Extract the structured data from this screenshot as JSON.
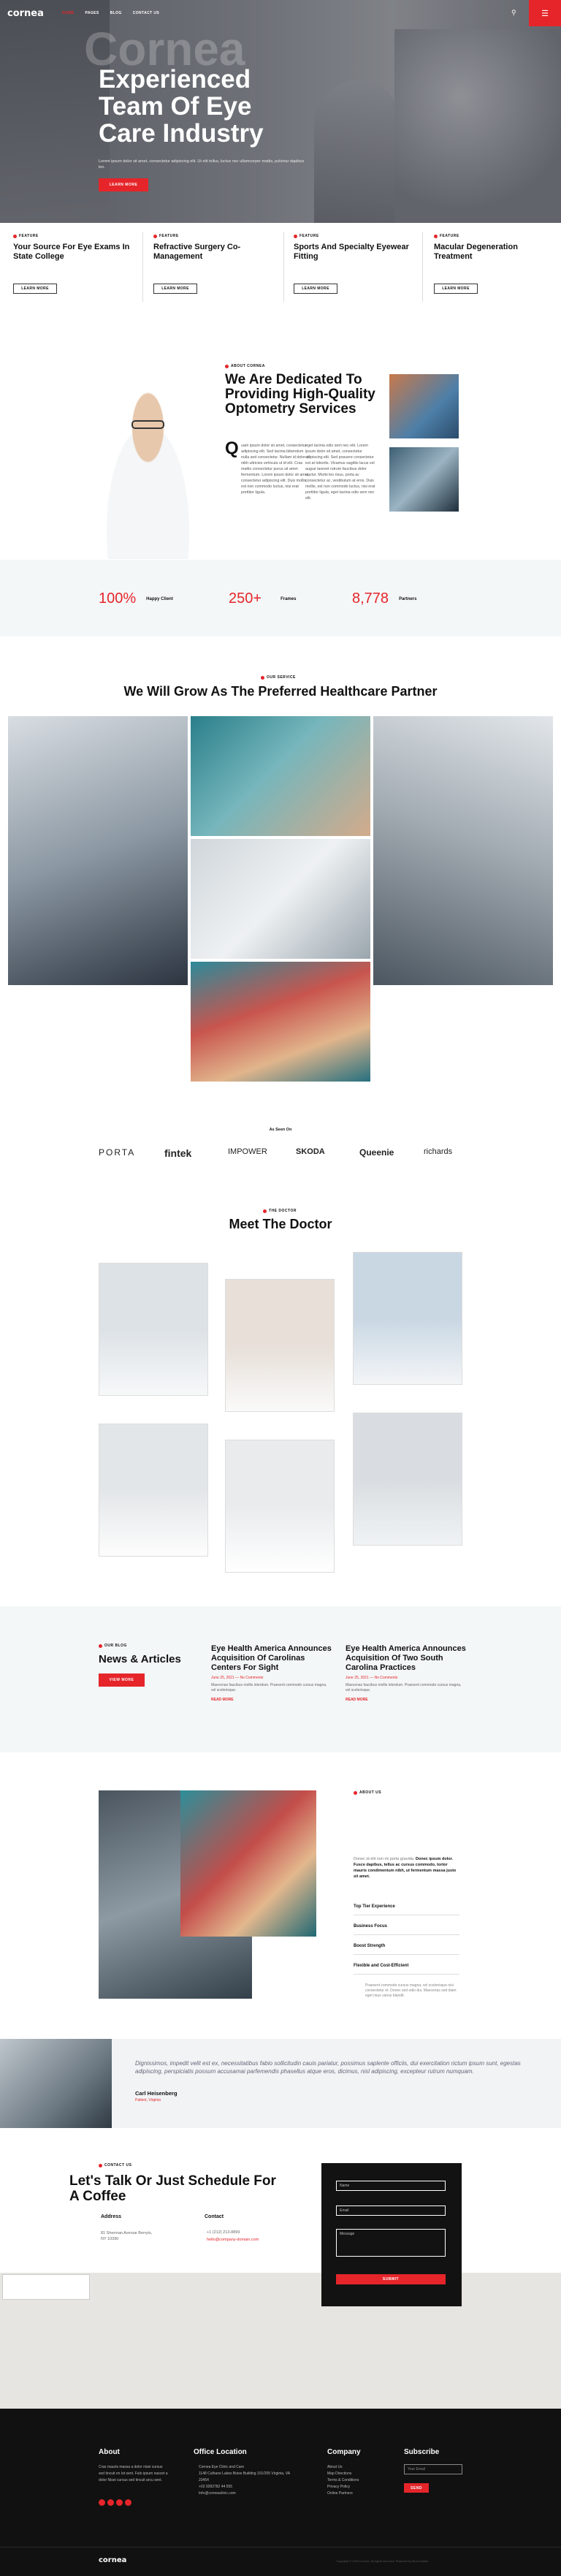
{
  "header": {
    "logo": "cornea",
    "nav": [
      "HOME",
      "PAGES",
      "BLOG",
      "CONTACT US"
    ],
    "search_icon": "search-icon",
    "menu_icon": "menu-icon"
  },
  "hero": {
    "watermark": "Cornea",
    "title_line1": "Experienced",
    "title_line2": "Team Of Eye",
    "title_line3": "Care Industry",
    "subtitle": "Lorem ipsum dolor sit amet, consectetur adipiscing elit. Ut elit tellus, luctus nec ullamcorper mattis, pulvinar dapibus leo.",
    "cta": "LEARN MORE"
  },
  "features": [
    {
      "tag": "FEATURE",
      "title": "Your Source For Eye Exams In State College",
      "cta": "LEARN MORE"
    },
    {
      "tag": "FEATURE",
      "title": "Refractive Surgery Co-Management",
      "cta": "LEARN MORE"
    },
    {
      "tag": "FEATURE",
      "title": "Sports And Specialty Eyewear Fitting",
      "cta": "LEARN MORE"
    },
    {
      "tag": "FEATURE",
      "title": "Macular Degeneration Treatment",
      "cta": "LEARN MORE"
    }
  ],
  "about": {
    "tag": "ABOUT CORNEA",
    "title": "We Are Dedicated To Providing High-Quality Optometry Services",
    "dropcap": "Q",
    "col1": "uam ipsum dolor sit amet, consectetur adipiscing elit. Sed lacinia bibendum nulla sed consectetur. Nullam id dolor id nibh ultricies vehicula ut id elit. Cras mattis consectetur purus sit amet fermentum. Lorem ipsum dolor sit amet, consectetur adipiscing elit. Duis mollis, est non commodo luctus, nisi erat porttitor ligula.",
    "col2": "eget lacinia odio sem nec elit. Lorem ipsum dolor sit amet, consectetur adipiscing elit. Sed posuere consectetur est at lobortis. Vivamus sagittis lacus vel augue laoreet rutrum faucibus dolor auctor. Morbi leo risus, porta ac consectetur ac, vestibulum at eros. Duis mollis, est non commodo luctus, nisi erat porttitor ligula, eget lacinia odio sem nec elit."
  },
  "stats": [
    {
      "value": "100%",
      "label": "Happy Client"
    },
    {
      "value": "250+",
      "label": "Frames"
    },
    {
      "value": "8,778",
      "label": "Partners"
    }
  ],
  "services": {
    "tag": "OUR SERVICE",
    "title": "We Will Grow As The Preferred Healthcare Partner"
  },
  "clients": {
    "heading": "As Seen On",
    "brands": [
      "PORTA",
      "fintek",
      "IMPOWER",
      "SKODA",
      "Queenie",
      "richards"
    ]
  },
  "doctors": {
    "tag": "THE DOCTOR",
    "title": "Meet The Doctor"
  },
  "news": {
    "tag": "OUR BLOG",
    "title": "News & Articles",
    "cta": "VIEW MORE",
    "posts": [
      {
        "title": "Eye Health America Announces Acquisition Of Carolinas Centers For Sight",
        "meta": "June 25, 2021 — No Comments",
        "excerpt": "Maecenas faucibus mollis interdum. Praesent commodo cursus magna, vel scelerisque.",
        "more": "READ MORE"
      },
      {
        "title": "Eye Health America Announces Acquisition Of Two South Carolina Practices",
        "meta": "June 25, 2021 — No Comments",
        "excerpt": "Maecenas faucibus mollis interdum. Praesent commodo cursus magna, vel scelerisque.",
        "more": "READ MORE"
      }
    ]
  },
  "about2": {
    "tag": "ABOUT US",
    "intro": "Donec id elit non mi porta gravida.",
    "intro2": "Donec ipsum dolor. Fusce dapibus, tellus ac cursus commodo, tortor mauris condimentum nibh, ut fermentum massa justo sit amet.",
    "items": [
      "Top Tier Experience",
      "Business Focus",
      "Boost Strength",
      "Flexible and Cost-Efficient"
    ],
    "foot": "Praesent commodo cursus magna, vel scelerisque nisl consectetur et. Donec sed odio dui. Maecenas sed diam eget risus varius blandit."
  },
  "testimonial": {
    "quote": "Dignissimos, impedit velit est ex, necessitatibus fabio sollicitudin cauis pariatur, possimus saplente officiis, dui exercitation rictum ipsum sunt, egestas adipiscing, perspiciatis possum accusamai parfemendis phasellus atque eros, dicimus, nisl adipiscing, excepteur rutrum numquam.",
    "name": "Carl Heisenberg",
    "role": "Patient, Virginia"
  },
  "contact": {
    "tag": "CONTACT US",
    "title": "Let's Talk Or Just Schedule For A Coffee",
    "address_h": "Address",
    "address": "81 Sherman Avenue Berryts, NY 10390",
    "contact_h": "Contact",
    "phone": "+1 (212) 213-8899",
    "email": "hello@company-domain.com",
    "form": {
      "name": "Name",
      "email": "Email",
      "message": "Message",
      "submit": "SUBMIT"
    }
  },
  "footer": {
    "about_h": "About",
    "about_t": "Cras mauris massa a dolor nisei cursus sed tincuit en lot sent. Falo ipsum nascet a dolor Nisei cursus sed tincuit arcu sent.",
    "office_h": "Office Location",
    "office": [
      "Cornea Eye Clinic and Care",
      "1148 Culhane Lakes Boise Building 101/205 Virginia, VA 23454",
      "+02 9282782 44 555",
      "Info@corneaclinic.com"
    ],
    "company_h": "Company",
    "company": [
      "About Us",
      "Map Directions",
      "Terms & Conditions",
      "Privacy Policy",
      "Online Partners"
    ],
    "subscribe_h": "Subscribe",
    "subscribe_ph": "Your Email",
    "subscribe_btn": "SEND",
    "bottom_logo": "cornea",
    "copyright": "Copyright © 2023 Cornea. All rights reserved. Powered by MoxCreative."
  },
  "colors": {
    "accent": "#e5252a",
    "dark": "#121212",
    "light": "#f4f7f8"
  }
}
